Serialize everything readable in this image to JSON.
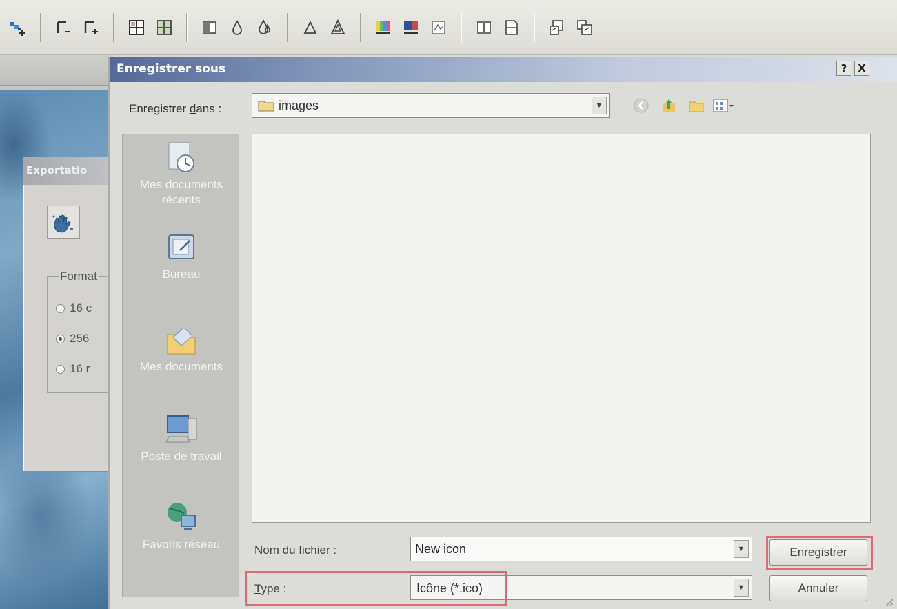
{
  "toolbar": {
    "icons": [
      "add-color-icon",
      "gamma-minus-icon",
      "gamma-plus-icon",
      "grid-icon",
      "grid-color-icon",
      "contrast-icon",
      "drop-icon",
      "drops-icon",
      "triangle-icon",
      "triangles-icon",
      "palette-icon",
      "screen-icon",
      "image-effect-icon",
      "book-icon",
      "page-icon",
      "export-icon",
      "import-icon"
    ]
  },
  "background": {
    "export_dialog": {
      "title": "Exportatio",
      "format_label": "Format",
      "options": [
        "16 c",
        "256",
        "16 r"
      ],
      "selected_index": 1
    }
  },
  "dialog": {
    "title": "Enregistrer sous",
    "help_label": "?",
    "close_label": "X",
    "look_in": {
      "label_prefix": "Enregistrer ",
      "label_accel": "d",
      "label_suffix": "ans :",
      "value": "images"
    },
    "places": [
      {
        "icon": "recent-documents-icon",
        "label": "Mes documents récents"
      },
      {
        "icon": "desktop-icon",
        "label": "Bureau"
      },
      {
        "icon": "my-documents-icon",
        "label": "Mes documents"
      },
      {
        "icon": "my-computer-icon",
        "label": "Poste de travail"
      },
      {
        "icon": "network-places-icon",
        "label": "Favoris réseau"
      }
    ],
    "filename": {
      "label_accel": "N",
      "label_rest": "om du fichier :",
      "value": "New icon"
    },
    "type": {
      "label_accel": "T",
      "label_rest": "ype :",
      "value": "Icône (*.ico)"
    },
    "buttons": {
      "save_accel": "E",
      "save_rest": "nregistrer",
      "cancel": "Annuler"
    },
    "colors": {
      "highlight": "#dd6b76",
      "titlebar_start": "#566a97"
    }
  }
}
